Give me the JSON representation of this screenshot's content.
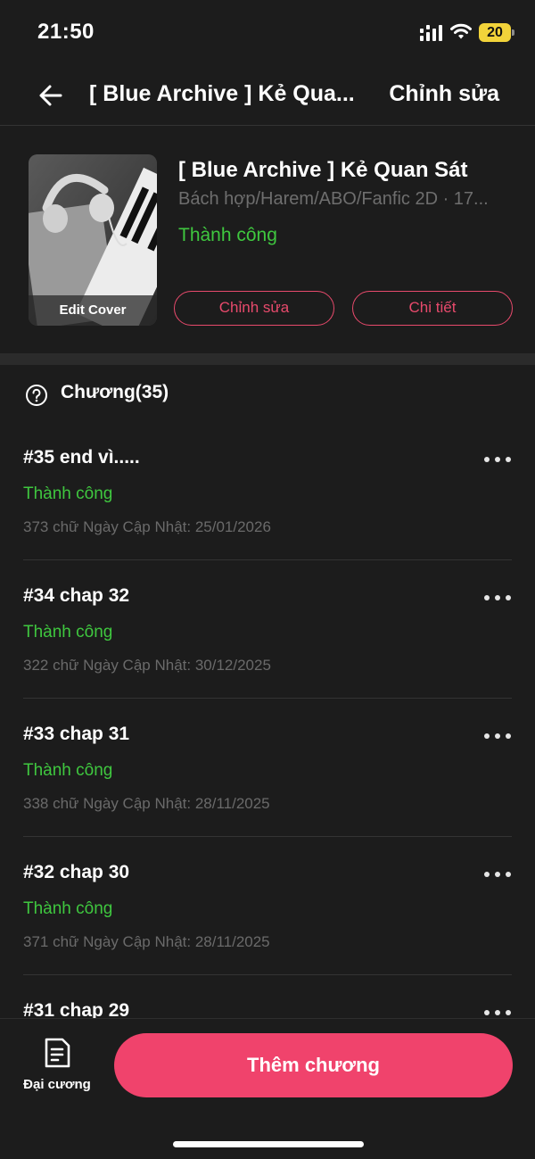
{
  "status_bar": {
    "time": "21:50",
    "battery": "20"
  },
  "nav": {
    "title": "[ Blue Archive ] Kẻ Qua...",
    "edit_label": "Chỉnh sửa"
  },
  "book": {
    "cover_edit_label": "Edit Cover",
    "title": "[ Blue Archive ] Kẻ Quan Sát",
    "genre": "Bách hợp/Harem/ABO/Fanfic 2D · 17...",
    "status": "Thành công",
    "edit_button": "Chỉnh sửa",
    "detail_button": "Chi tiết"
  },
  "chapters": {
    "title": "Chương(35)",
    "items": [
      {
        "title": "#35 end vì.....",
        "status": "Thành công",
        "meta": "373 chữ Ngày Cập Nhật: 25/01/2026"
      },
      {
        "title": "#34 chap 32",
        "status": "Thành công",
        "meta": "322 chữ Ngày Cập Nhật: 30/12/2025"
      },
      {
        "title": "#33 chap 31",
        "status": "Thành công",
        "meta": "338 chữ Ngày Cập Nhật: 28/11/2025"
      },
      {
        "title": "#32 chap 30",
        "status": "Thành công",
        "meta": "371 chữ Ngày Cập Nhật: 28/11/2025"
      },
      {
        "title": "#31 chap 29",
        "status": "",
        "meta": ""
      }
    ]
  },
  "bottom_bar": {
    "outline_label": "Đại cương",
    "add_chapter_label": "Thêm chương"
  },
  "colors": {
    "accent": "#f0436c",
    "success": "#3fc73f",
    "background": "#1c1c1c"
  }
}
